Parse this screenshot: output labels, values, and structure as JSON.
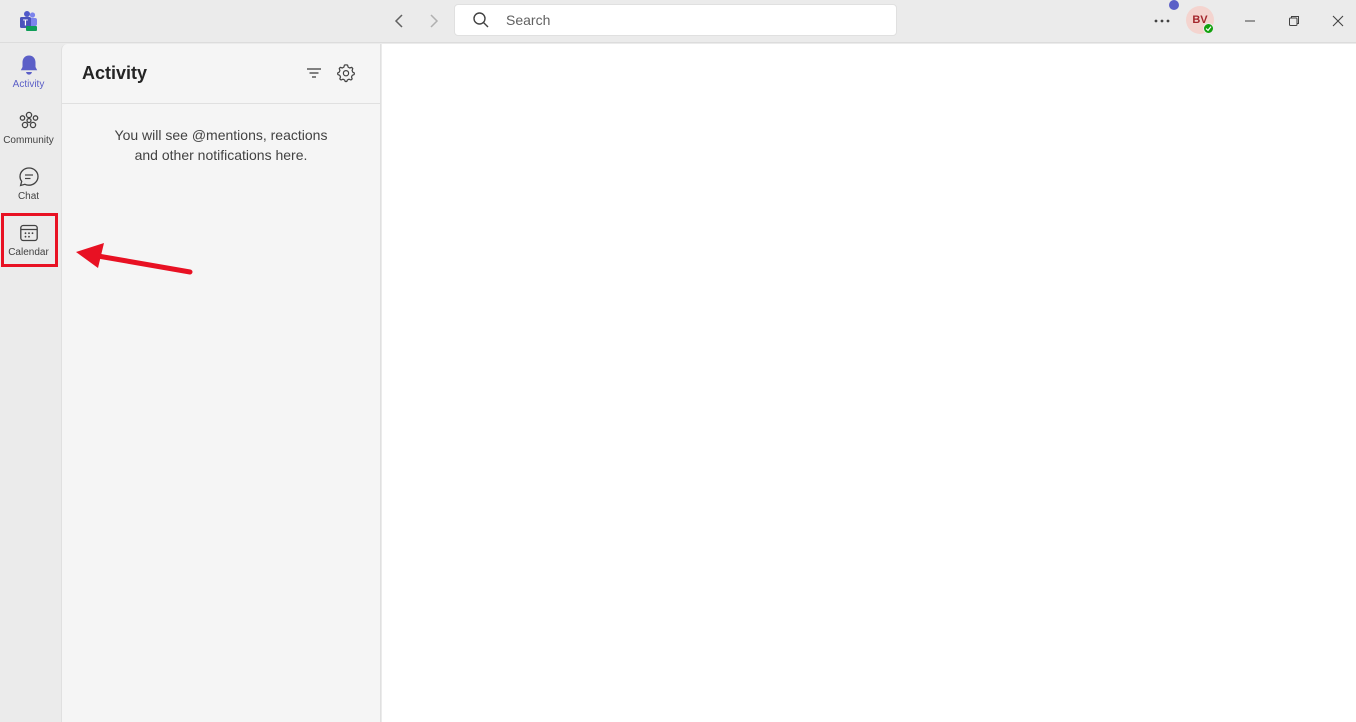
{
  "titlebar": {
    "search": {
      "placeholder": "Search"
    },
    "avatar_initials": "BV",
    "icons": [
      "teams-logo-icon",
      "chevron-left-icon",
      "chevron-right-icon",
      "search-icon",
      "more-icon",
      "minimize-icon",
      "restore-icon",
      "close-icon"
    ]
  },
  "rail": {
    "items": [
      {
        "label": "Activity",
        "icon": "bell-icon",
        "active": true
      },
      {
        "label": "Community",
        "icon": "community-icon",
        "active": false
      },
      {
        "label": "Chat",
        "icon": "chat-icon",
        "active": false
      },
      {
        "label": "Calendar",
        "icon": "calendar-icon",
        "active": false
      }
    ]
  },
  "activity_panel": {
    "title": "Activity",
    "empty_line1": "You will see @mentions, reactions",
    "empty_line2": "and other notifications here."
  },
  "colors": {
    "accent": "#5b5fc7",
    "annotation": "#e81123",
    "presence": "#13a10e"
  }
}
